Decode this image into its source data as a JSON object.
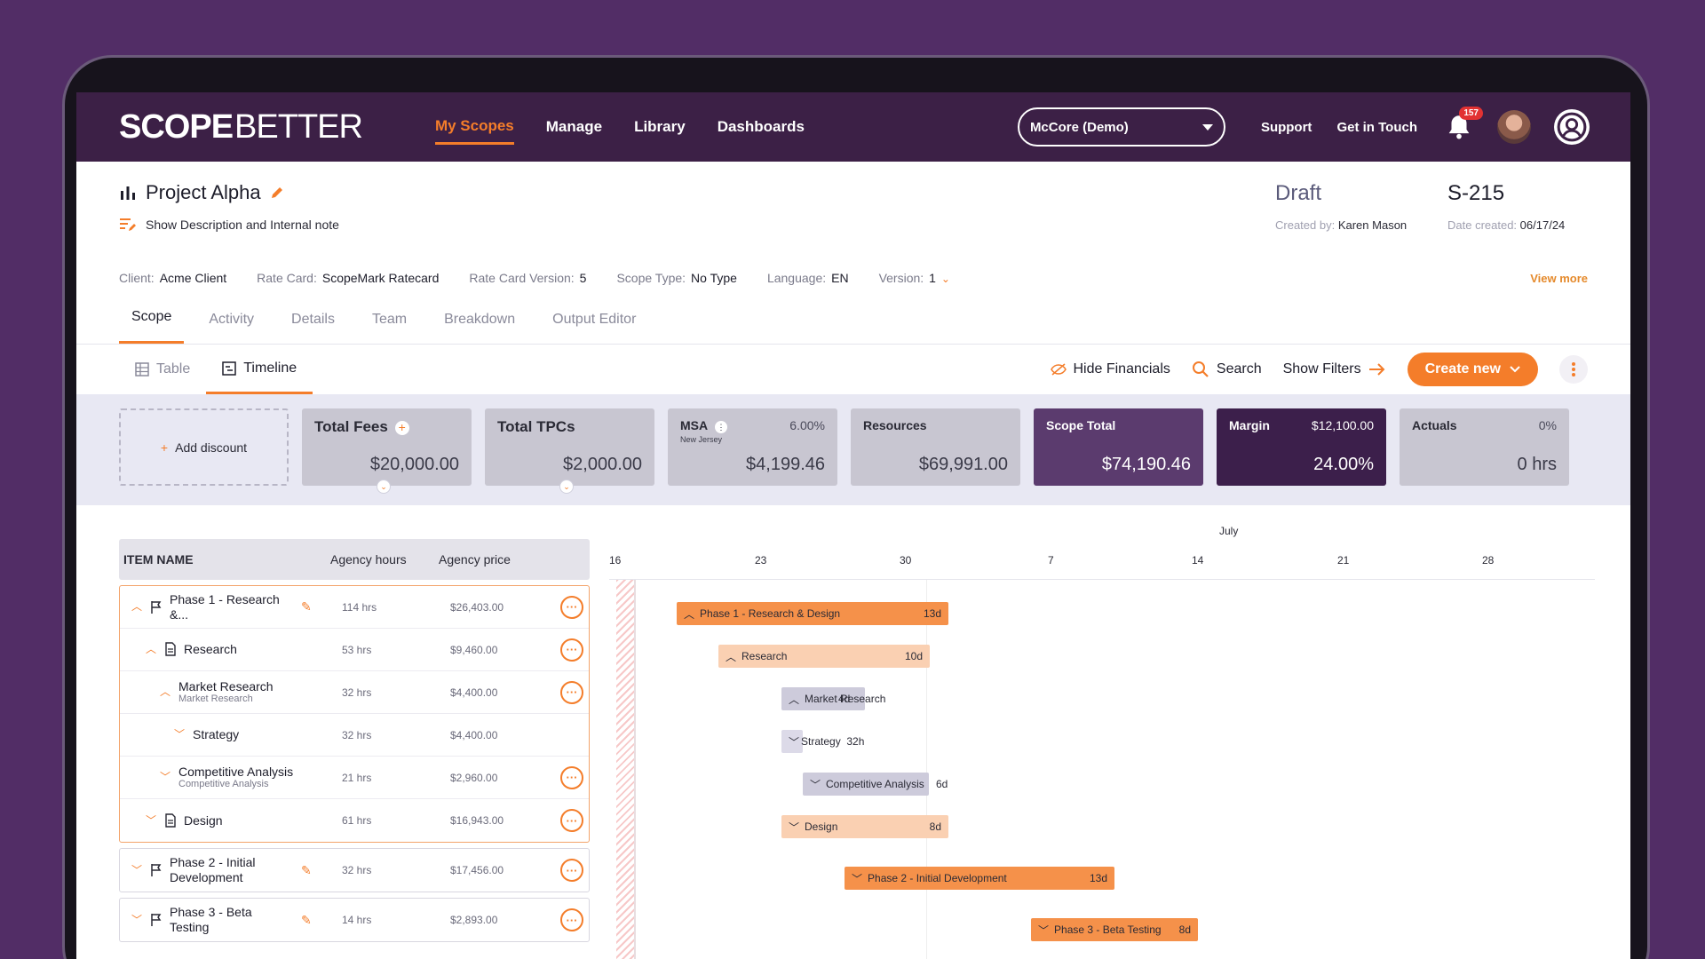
{
  "nav": {
    "logo_scope": "SCOPE",
    "logo_better": "BETTER",
    "links": [
      "My Scopes",
      "Manage",
      "Library",
      "Dashboards"
    ],
    "account": "McCore (Demo)",
    "support": "Support",
    "get_in_touch": "Get in Touch",
    "notif_count": "157"
  },
  "project": {
    "title": "Project Alpha",
    "note_link": "Show Description and Internal note",
    "status": "Draft",
    "scope_id": "S-215",
    "created_by_label": "Created by:",
    "created_by": "Karen Mason",
    "date_created_label": "Date created:",
    "date_created": "06/17/24"
  },
  "meta": {
    "client_label": "Client:",
    "client": "Acme Client",
    "rate_card_label": "Rate Card:",
    "rate_card": "ScopeMark Ratecard",
    "rcv_label": "Rate Card Version:",
    "rcv": "5",
    "scope_type_label": "Scope Type:",
    "scope_type": "No Type",
    "language_label": "Language:",
    "language": "EN",
    "version_label": "Version:",
    "version": "1",
    "view_more": "View more"
  },
  "tabs": [
    "Scope",
    "Activity",
    "Details",
    "Team",
    "Breakdown",
    "Output Editor"
  ],
  "subtabs": {
    "table": "Table",
    "timeline": "Timeline"
  },
  "actions": {
    "hide_financials": "Hide Financials",
    "search": "Search",
    "show_filters": "Show Filters",
    "create_new": "Create new"
  },
  "cards": {
    "add_discount": "Add discount",
    "total_fees_label": "Total Fees",
    "total_fees": "$20,000.00",
    "total_tpcs_label": "Total TPCs",
    "total_tpcs": "$2,000.00",
    "msa_label": "MSA",
    "msa_sub": "New Jersey",
    "msa_pct": "6.00%",
    "msa_val": "$4,199.46",
    "resources_label": "Resources",
    "resources": "$69,991.00",
    "scope_total_label": "Scope Total",
    "scope_total": "$74,190.46",
    "margin_label": "Margin",
    "margin_amt": "$12,100.00",
    "margin_pct": "24.00%",
    "actuals_label": "Actuals",
    "actuals_pct": "0%",
    "actuals": "0 hrs"
  },
  "table": {
    "headers": {
      "name": "ITEM NAME",
      "hours": "Agency hours",
      "price": "Agency price"
    },
    "phase1": {
      "name": "Phase 1 - Research &...",
      "hours": "114 hrs",
      "price": "$26,403.00",
      "children": [
        {
          "name": "Research",
          "sub": "",
          "hours": "53 hrs",
          "price": "$9,460.00"
        },
        {
          "name": "Market Research",
          "sub": "Market Research",
          "hours": "32 hrs",
          "price": "$4,400.00"
        },
        {
          "name": "Strategy",
          "sub": "",
          "hours": "32 hrs",
          "price": "$4,400.00"
        },
        {
          "name": "Competitive Analysis",
          "sub": "Competitive Analysis",
          "hours": "21 hrs",
          "price": "$2,960.00"
        },
        {
          "name": "Design",
          "sub": "",
          "hours": "61 hrs",
          "price": "$16,943.00"
        }
      ]
    },
    "phase2": {
      "name": "Phase 2 - Initial Development",
      "hours": "32 hrs",
      "price": "$17,456.00"
    },
    "phase3": {
      "name": "Phase 3 - Beta Testing",
      "hours": "14 hrs",
      "price": "$2,893.00"
    }
  },
  "timeline": {
    "month": "July",
    "ticks": [
      "16",
      "23",
      "30",
      "7",
      "14",
      "21",
      "28"
    ],
    "bars": [
      {
        "label": "Phase 1 - Research & Design",
        "dur": "13d"
      },
      {
        "label": "Research",
        "dur": "10d"
      },
      {
        "label": "Market Research",
        "dur": "4d"
      },
      {
        "label": "Strategy",
        "dur": "32h"
      },
      {
        "label": "Competitive Analysis",
        "dur": "6d"
      },
      {
        "label": "Design",
        "dur": "8d"
      },
      {
        "label": "Phase 2 - Initial Development",
        "dur": "13d"
      },
      {
        "label": "Phase 3 - Beta Testing",
        "dur": "8d"
      }
    ]
  },
  "colors": {
    "accent": "#f47d2a",
    "nav_bg": "#3c2046",
    "page_bg": "#522d66"
  }
}
